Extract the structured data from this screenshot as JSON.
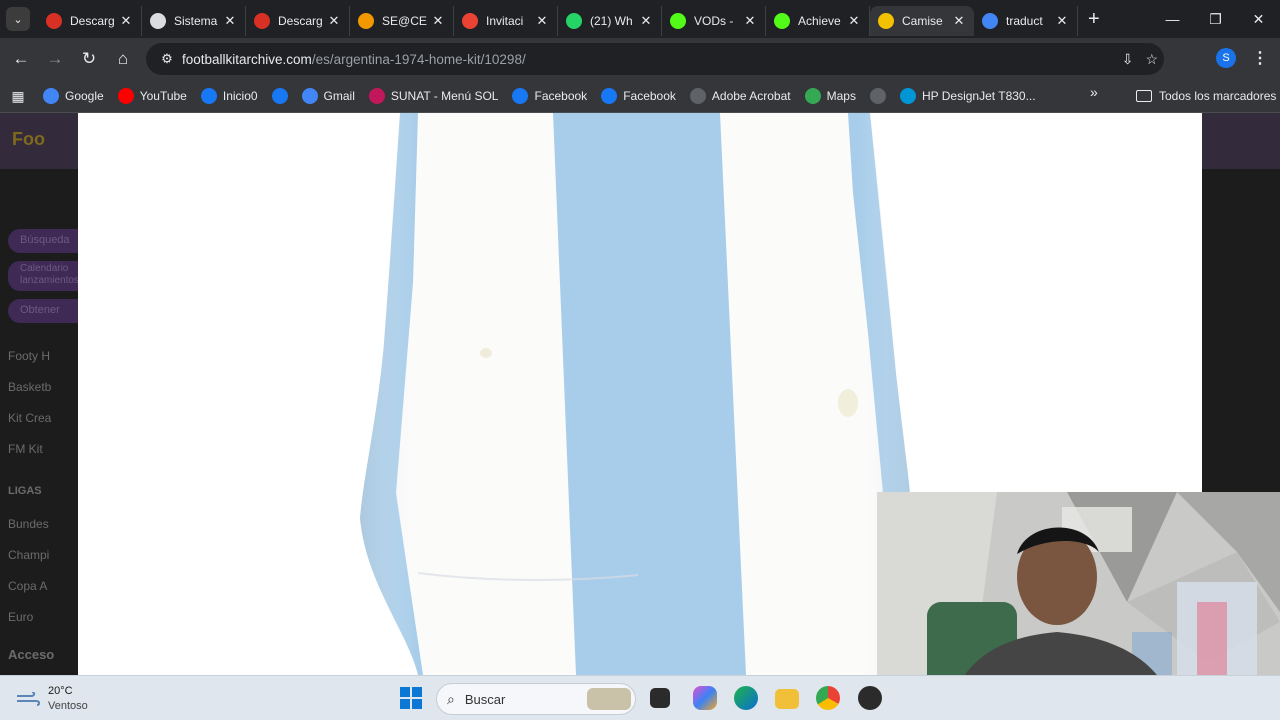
{
  "tabs": [
    {
      "title": "Descarg",
      "favicon": "red-heart-icon",
      "color": "#d93025"
    },
    {
      "title": "Sistema",
      "favicon": "globe-icon",
      "color": "#dadce0"
    },
    {
      "title": "Descarg",
      "favicon": "red-heart-icon",
      "color": "#d93025"
    },
    {
      "title": "SE@CE",
      "favicon": "orange-dot-icon",
      "color": "#f29900"
    },
    {
      "title": "Invitaci",
      "favicon": "gmail-icon",
      "color": "#ea4335"
    },
    {
      "title": "(21) Wh",
      "favicon": "whatsapp-icon",
      "color": "#25d366"
    },
    {
      "title": "VODs -",
      "favicon": "kick-icon",
      "color": "#53fc18"
    },
    {
      "title": "Achieve",
      "favicon": "kick-icon",
      "color": "#53fc18"
    },
    {
      "title": "Camise",
      "favicon": "footballkit-icon",
      "color": "#f2c200",
      "active": true
    },
    {
      "title": "traduct",
      "favicon": "google-icon",
      "color": "#4285f4"
    }
  ],
  "address_bar": {
    "domain": "footballkitarchive.com",
    "path": "/es/argentina-1974-home-kit/10298/"
  },
  "profile_initial": "S",
  "bookmarks": [
    {
      "label": "Google",
      "icon": "google-icon",
      "color": "#4285f4"
    },
    {
      "label": "YouTube",
      "icon": "youtube-icon",
      "color": "#ff0000"
    },
    {
      "label": "Inicio0",
      "icon": "facebook-icon",
      "color": "#1877f2"
    },
    {
      "label": "",
      "icon": "facebook-icon",
      "color": "#1877f2"
    },
    {
      "label": "Gmail",
      "icon": "google-icon",
      "color": "#4285f4"
    },
    {
      "label": "SUNAT - Menú SOL",
      "icon": "sunat-icon",
      "color": "#c2185b"
    },
    {
      "label": "Facebook",
      "icon": "facebook-icon",
      "color": "#1877f2"
    },
    {
      "label": "Facebook",
      "icon": "facebook-icon",
      "color": "#1877f2"
    },
    {
      "label": "Adobe Acrobat",
      "icon": "acrobat-icon",
      "color": "#5f6368"
    },
    {
      "label": "Maps",
      "icon": "maps-icon",
      "color": "#34a853"
    },
    {
      "label": "",
      "icon": "chrome-icon",
      "color": "#5f6368"
    },
    {
      "label": "HP DesignJet T830...",
      "icon": "hp-icon",
      "color": "#0096d6"
    }
  ],
  "all_bookmarks_label": "Todos los marcadores",
  "site": {
    "logo": "Foo",
    "sidebar_pills": [
      "Búsqueda",
      "Calendario lanzamientos",
      "Obtener"
    ],
    "sidebar_items": [
      "Footy H",
      "Basketb",
      "Kit Crea",
      "FM Kit"
    ],
    "leagues_heading": "LIGAS",
    "league_items": [
      "Bundes",
      "Champi",
      "Copa A",
      "Euro"
    ],
    "access_heading": "Acceso"
  },
  "taskbar": {
    "temperature": "20°C",
    "weather_text": "Ventoso",
    "search_placeholder": "Buscar"
  },
  "colors": {
    "stripe_blue": "#a8cdea",
    "kit_white": "#fbfbfa"
  }
}
